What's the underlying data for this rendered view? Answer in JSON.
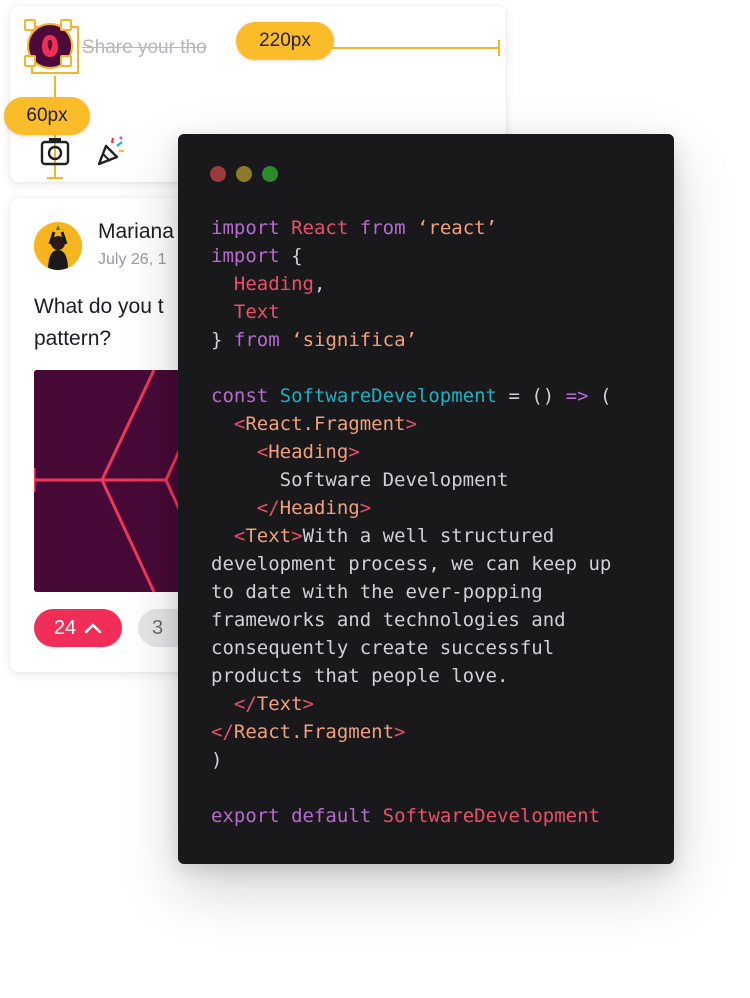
{
  "composer": {
    "placeholder": "Share your thoughts",
    "visible_text": "Share your tho",
    "measure_width_label": "220px",
    "measure_height_label": "60px",
    "tools": [
      "camera-icon",
      "party-popper-icon"
    ]
  },
  "post": {
    "author": "Mariana",
    "date": "July 26, 1",
    "text": "What do you t\npattern?",
    "votes": "24",
    "comments": "3"
  },
  "code": {
    "lines": [
      "import React from ‘react’",
      "import {",
      "  Heading,",
      "  Text",
      "} from ‘significa’",
      "",
      "const SoftwareDevelopment = () => (",
      "  <React.Fragment>",
      "    <Heading>",
      "      Software Development",
      "    </Heading>",
      "  <Text>With a well structured",
      "development process, we can keep up",
      "to date with the ever-popping",
      "frameworks and technologies and",
      "consequently create successful",
      "products that people love.",
      "  </Text>",
      "</React.Fragment>",
      ")",
      "",
      "export default SoftwareDevelopment"
    ]
  },
  "colors": {
    "accent_yellow": "#fbbc2a",
    "brand_pink": "#f02e57",
    "code_bg": "#19191c",
    "image_bg": "#470a37"
  }
}
